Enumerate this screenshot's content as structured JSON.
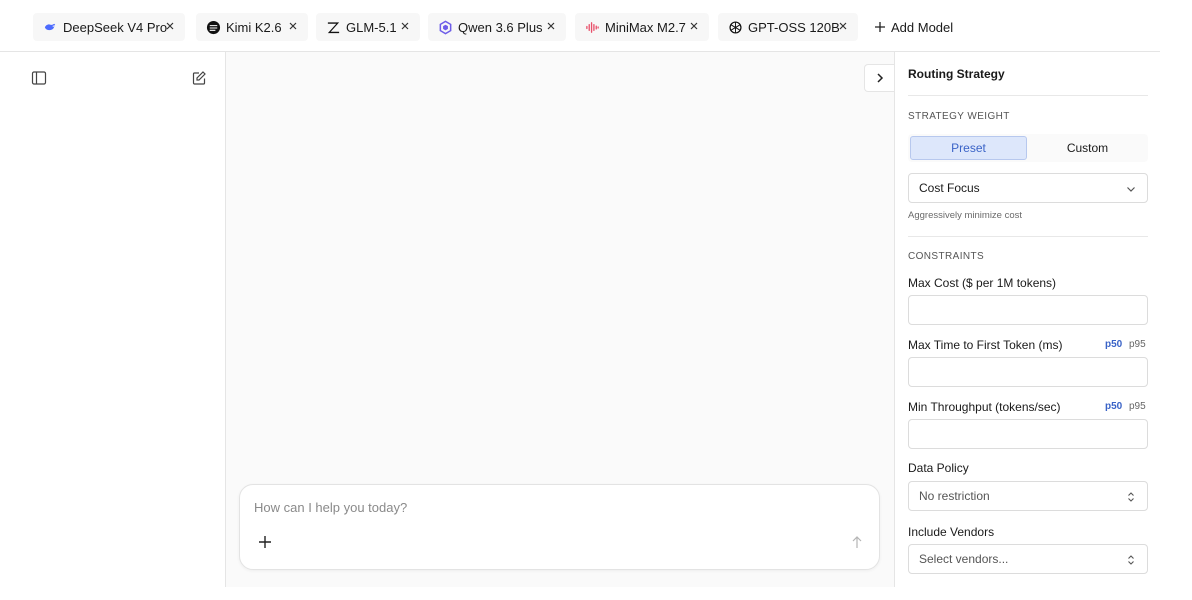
{
  "tabs": [
    {
      "label": "DeepSeek V4 Pro",
      "icon": "deepseek-whale-icon"
    },
    {
      "label": "Kimi K2.6",
      "icon": "kimi-logo-icon"
    },
    {
      "label": "GLM-5.1",
      "icon": "zhipu-z-logo-icon"
    },
    {
      "label": "Qwen 3.6 Plus",
      "icon": "qwen-logo-icon"
    },
    {
      "label": "MiniMax M2.7",
      "icon": "minimax-logo-icon"
    },
    {
      "label": "GPT-OSS 120B",
      "icon": "openai-logo-icon"
    }
  ],
  "add_model_label": "Add Model",
  "composer": {
    "placeholder": "How can I help you today?"
  },
  "panel": {
    "title": "Routing Strategy",
    "strategy_weight_label": "STRATEGY WEIGHT",
    "preset_label": "Preset",
    "custom_label": "Custom",
    "selected_preset": "Cost Focus",
    "preset_hint": "Aggressively minimize cost",
    "constraints_label": "CONSTRAINTS",
    "max_cost_label": "Max Cost ($ per 1M tokens)",
    "max_ttft_label": "Max Time to First Token (ms)",
    "min_throughput_label": "Min Throughput (tokens/sec)",
    "p50_label": "p50",
    "p95_label": "p95",
    "data_policy_label": "Data Policy",
    "data_policy_value": "No restriction",
    "include_vendors_label": "Include Vendors",
    "include_vendors_placeholder": "Select vendors..."
  },
  "colors": {
    "accent": "#3a63c7",
    "accent_bg": "#dde7fb",
    "border": "#e5e5e5"
  }
}
